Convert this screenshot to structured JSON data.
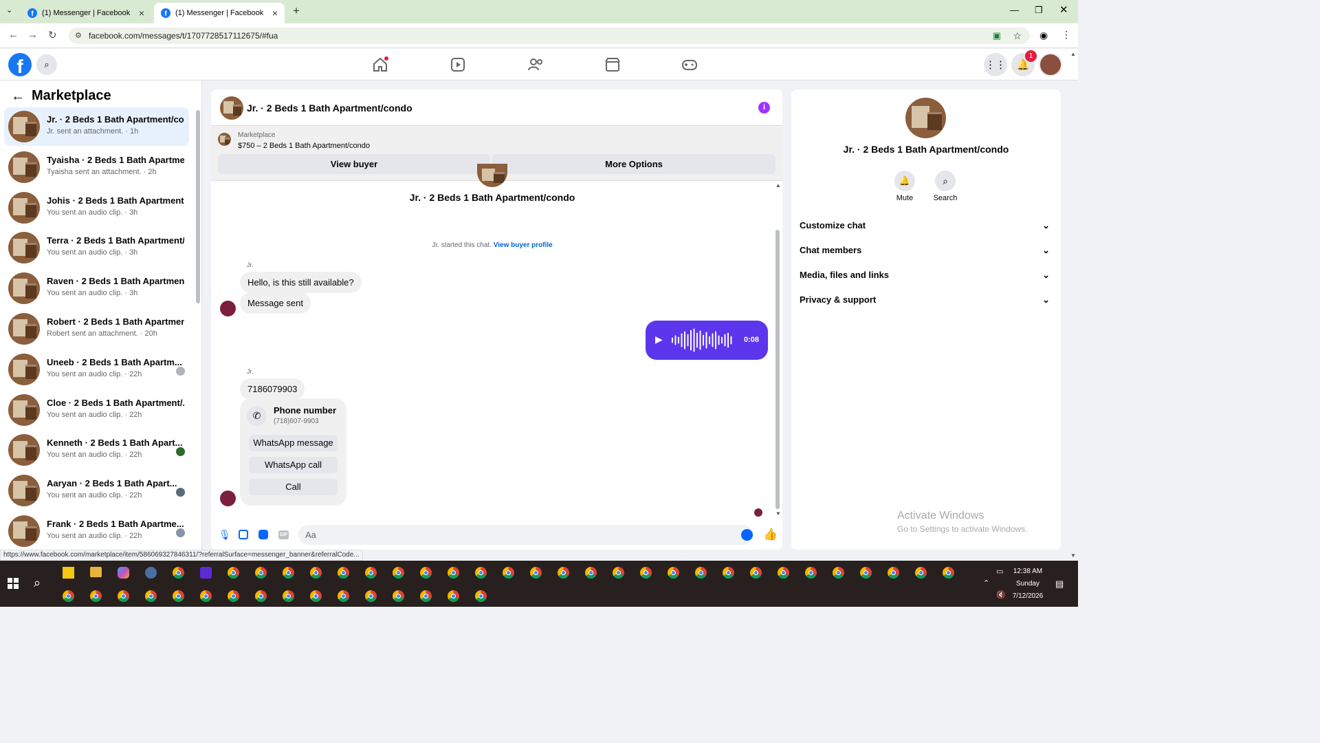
{
  "browser": {
    "tabs": [
      {
        "title": "(1) Messenger | Facebook"
      },
      {
        "title": "(1) Messenger | Facebook"
      }
    ],
    "url": "facebook.com/messages/t/1707728517112675/#fua"
  },
  "fb": {
    "notification_count": "1"
  },
  "left": {
    "title": "Marketplace",
    "conversations": [
      {
        "name": "Jr. · 2 Beds 1 Bath Apartment/co...",
        "sub": "Jr. sent an attachment. · 1h"
      },
      {
        "name": "Tyaisha · 2 Beds 1 Bath Apartme...",
        "sub": "Tyaisha sent an attachment. · 2h"
      },
      {
        "name": "Johis · 2 Beds 1 Bath Apartment/...",
        "sub": "You sent an audio clip. · 3h"
      },
      {
        "name": "Terra · 2 Beds 1 Bath Apartment/...",
        "sub": "You sent an audio clip. · 3h"
      },
      {
        "name": "Raven · 2 Beds 1 Bath Apartmen...",
        "sub": "You sent an audio clip. · 3h"
      },
      {
        "name": "Robert · 2 Beds 1 Bath Apartmen...",
        "sub": "Robert sent an attachment. · 20h"
      },
      {
        "name": "Uneeb · 2 Beds 1 Bath Apartm...",
        "sub": "You sent an audio clip. · 22h"
      },
      {
        "name": "Cloe · 2 Beds 1 Bath Apartment/...",
        "sub": "You sent an audio clip. · 22h"
      },
      {
        "name": "Kenneth · 2 Beds 1 Bath Apart...",
        "sub": "You sent an audio clip. · 22h"
      },
      {
        "name": "Aaryan · 2 Beds 1 Bath Apart...",
        "sub": "You sent an audio clip. · 22h"
      },
      {
        "name": "Frank · 2 Beds 1 Bath Apartme...",
        "sub": "You sent an audio clip. · 22h"
      }
    ]
  },
  "chat": {
    "title": "Jr. · 2 Beds 1 Bath Apartment/condo",
    "banner_label": "Marketplace",
    "banner_listing": "$750 – 2 Beds 1 Bath Apartment/condo",
    "view_buyer": "View buyer",
    "more_options": "More Options",
    "profile_name": "Jr. · 2 Beds 1 Bath Apartment/condo",
    "started": "Jr. started this chat.",
    "view_profile": "View buyer profile",
    "sender": "Jr.",
    "msg1": "Hello, is this still available?",
    "msg2": "Message sent",
    "audio_duration": "0:08",
    "sender2": "Jr.",
    "phone_msg": "7186079903",
    "phone_title": "Phone number",
    "phone_num": "(718)607-9903",
    "whatsapp_msg": "WhatsApp message",
    "whatsapp_call": "WhatsApp call",
    "call": "Call",
    "input_placeholder": "Aa"
  },
  "right": {
    "name": "Jr. · 2 Beds 1 Bath Apartment/condo",
    "mute": "Mute",
    "search": "Search",
    "sections": [
      "Customize chat",
      "Chat members",
      "Media, files and links",
      "Privacy & support"
    ]
  },
  "watermark": {
    "title": "Activate Windows",
    "sub": "Go to Settings to activate Windows."
  },
  "status_url": "https://www.facebook.com/marketplace/item/586069327846311/?referralSurface=messenger_banner&referralCode...",
  "clock": {
    "time": "12:38 AM",
    "day": "Sunday",
    "date": "7/12/2026"
  },
  "colors": {
    "accent": "#1877f2",
    "messenger": "#5b36ec",
    "info": "#a033ff"
  }
}
